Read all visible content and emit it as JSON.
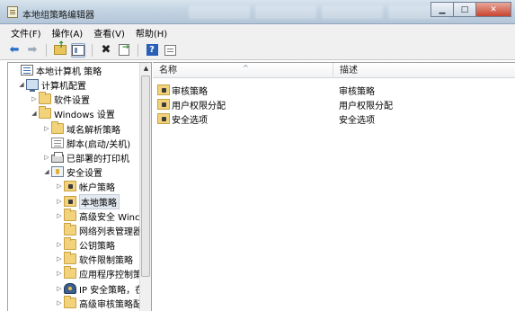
{
  "window": {
    "title": "本地组策略编辑器"
  },
  "menu": {
    "items": [
      "文件(F)",
      "操作(A)",
      "查看(V)",
      "帮助(H)"
    ]
  },
  "tree": {
    "nodes": [
      {
        "label": "本地计算机 策略",
        "icon": "policy-icon",
        "toggle": ""
      },
      {
        "label": "计算机配置",
        "icon": "computer-icon",
        "toggle": "expanded"
      },
      {
        "label": "软件设置",
        "icon": "folder-icon",
        "toggle": "collapsed"
      },
      {
        "label": "Windows 设置",
        "icon": "folder-icon",
        "toggle": "expanded"
      },
      {
        "label": "域名解析策略",
        "icon": "folder-icon",
        "toggle": "collapsed"
      },
      {
        "label": "脚本(启动/关机)",
        "icon": "script-icon",
        "toggle": ""
      },
      {
        "label": "已部署的打印机",
        "icon": "printer-icon",
        "toggle": "collapsed"
      },
      {
        "label": "安全设置",
        "icon": "shield-icon",
        "toggle": "expanded"
      },
      {
        "label": "帐户策略",
        "icon": "lock-folder-icon",
        "toggle": "collapsed"
      },
      {
        "label": "本地策略",
        "icon": "lock-folder-icon",
        "toggle": "collapsed"
      },
      {
        "label": "高级安全 Winc",
        "icon": "folder-icon",
        "toggle": "collapsed"
      },
      {
        "label": "网络列表管理器",
        "icon": "folder-icon",
        "toggle": ""
      },
      {
        "label": "公钥策略",
        "icon": "folder-icon",
        "toggle": "collapsed"
      },
      {
        "label": "软件限制策略",
        "icon": "folder-icon",
        "toggle": "collapsed"
      },
      {
        "label": "应用程序控制策",
        "icon": "folder-icon",
        "toggle": "collapsed"
      },
      {
        "label": "IP 安全策略，在",
        "icon": "ipsec-icon",
        "toggle": "collapsed"
      },
      {
        "label": "高级审核策略配",
        "icon": "folder-icon",
        "toggle": "collapsed"
      }
    ],
    "selected": "本地策略"
  },
  "list": {
    "columns": {
      "name": "名称",
      "description": "描述"
    },
    "rows": [
      {
        "name": "审核策略",
        "description": "审核策略"
      },
      {
        "name": "用户权限分配",
        "description": "用户权限分配"
      },
      {
        "name": "安全选项",
        "description": "安全选项"
      }
    ]
  }
}
